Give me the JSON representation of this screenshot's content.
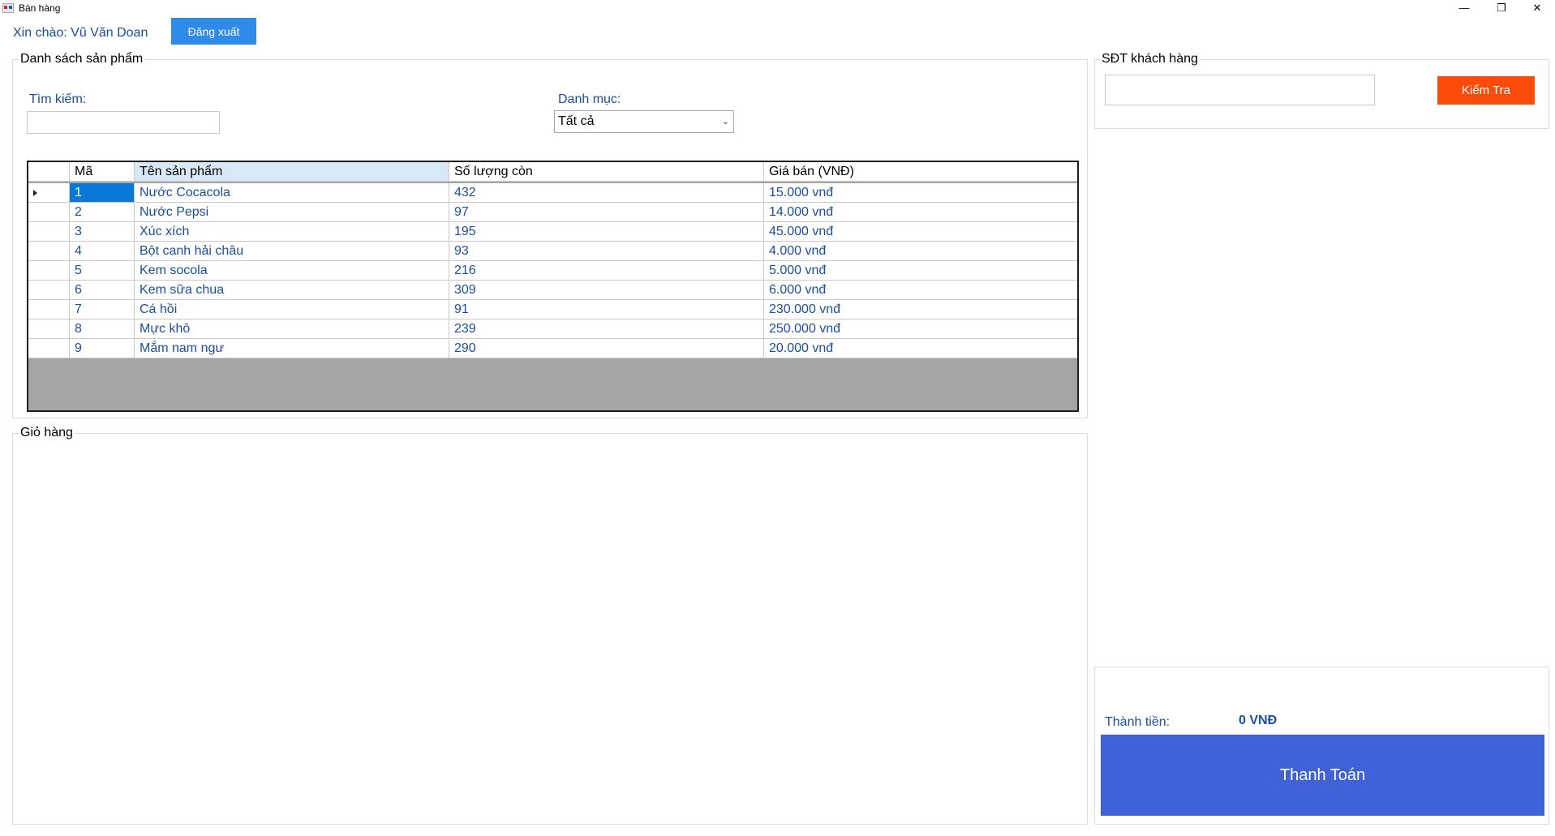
{
  "window": {
    "title": "Bán hàng",
    "minimize_glyph": "—",
    "maximize_glyph": "❐",
    "close_glyph": "✕"
  },
  "header": {
    "greeting": "Xin chào: Vũ Văn Doan",
    "logout_label": "Đăng xuất"
  },
  "products": {
    "group_title": "Danh sách sản phẩm",
    "search_label": "Tìm kiếm:",
    "search_value": "",
    "category_label": "Danh mục:",
    "category_selected": "Tất cả",
    "columns": [
      "Mã",
      "Tên sản phẩm",
      "Số lượng còn",
      "Giá bán (VNĐ)"
    ],
    "rows": [
      {
        "id": "1",
        "name": "Nước Cocacola",
        "qty": "432",
        "price": "15.000 vnđ"
      },
      {
        "id": "2",
        "name": "Nước Pepsi",
        "qty": "97",
        "price": "14.000 vnđ"
      },
      {
        "id": "3",
        "name": "Xúc xích",
        "qty": "195",
        "price": "45.000 vnđ"
      },
      {
        "id": "4",
        "name": "Bột canh hải châu",
        "qty": "93",
        "price": "4.000 vnđ"
      },
      {
        "id": "5",
        "name": "Kem socola",
        "qty": "216",
        "price": "5.000 vnđ"
      },
      {
        "id": "6",
        "name": "Kem sữa chua",
        "qty": "309",
        "price": "6.000 vnđ"
      },
      {
        "id": "7",
        "name": "Cá hồi",
        "qty": "91",
        "price": "230.000 vnđ"
      },
      {
        "id": "8",
        "name": "Mực khô",
        "qty": "239",
        "price": "250.000 vnđ"
      },
      {
        "id": "9",
        "name": "Mắm nam ngư",
        "qty": "290",
        "price": "20.000 vnđ"
      }
    ]
  },
  "cart": {
    "group_title": "Giỏ hàng"
  },
  "customer": {
    "group_title": "SĐT khách hàng",
    "phone_value": "",
    "check_label": "Kiểm Tra"
  },
  "checkout": {
    "total_label": "Thành tiền:",
    "total_value": "0 VNĐ",
    "pay_label": "Thanh Toán"
  },
  "colors": {
    "logout_button": "#2f8be8",
    "check_button": "#fa4b0a",
    "pay_button": "#3f62d8",
    "selection": "#0a78d7",
    "text_blue": "#1a4fa0"
  }
}
